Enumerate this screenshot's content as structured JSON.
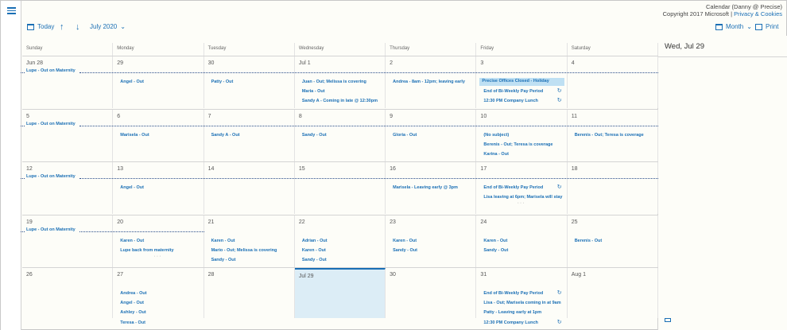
{
  "app": {
    "title_line": "Calendar (Danny @ Precise)",
    "copyright": "Copyright 2017 Microsoft",
    "separator": "|",
    "privacy_link": "Privacy & Cookies"
  },
  "toolbar": {
    "today_label": "Today",
    "month_label": "July 2020",
    "view_label": "Month",
    "print_label": "Print"
  },
  "days_of_week": [
    "Sunday",
    "Monday",
    "Tuesday",
    "Wednesday",
    "Thursday",
    "Friday",
    "Saturday"
  ],
  "weeks": [
    {
      "days": [
        "Jun 28",
        "29",
        "30",
        "Jul 1",
        "2",
        "3",
        "4"
      ],
      "span_event": "Lupe - Out on Maternity",
      "events": [
        [],
        [
          {
            "text": "Angel - Out"
          }
        ],
        [
          {
            "text": "Patty - Out"
          }
        ],
        [
          {
            "text": "Juan - Out; Melissa is covering"
          },
          {
            "text": "Maria - Out"
          },
          {
            "text": "Sandy A - Coming in late @ 12:30pm"
          }
        ],
        [
          {
            "text": "Andrea - 8am - 12pm; leaving early"
          }
        ],
        [
          {
            "text": "Precise Offices Closed - Holiday",
            "holiday": true
          },
          {
            "text": "End of Bi-Weekly Pay Period",
            "recur": true
          },
          {
            "text": "12:30 PM Company Lunch",
            "recur": true
          }
        ],
        []
      ]
    },
    {
      "days": [
        "5",
        "6",
        "7",
        "8",
        "9",
        "10",
        "11"
      ],
      "span_event": "Lupe - Out on Maternity",
      "events": [
        [],
        [
          {
            "text": "Marisela - Out"
          }
        ],
        [
          {
            "text": "Sandy A - Out"
          }
        ],
        [
          {
            "text": "Sandy - Out"
          }
        ],
        [
          {
            "text": "Gloria - Out"
          }
        ],
        [
          {
            "text": "(No subject)"
          },
          {
            "text": "Berenis - Out; Teresa is coverage"
          },
          {
            "text": "Karina - Out"
          }
        ],
        [
          {
            "text": "Berenis - Out; Teresa is coverage"
          }
        ]
      ]
    },
    {
      "days": [
        "12",
        "13",
        "14",
        "15",
        "16",
        "17",
        "18"
      ],
      "span_event": "Lupe - Out on Maternity",
      "events": [
        [],
        [
          {
            "text": "Angel - Out"
          }
        ],
        [],
        [],
        [
          {
            "text": "Marisela - Leaving early @ 3pm"
          }
        ],
        [
          {
            "text": "End of Bi-Weekly Pay Period",
            "recur": true
          },
          {
            "text": "Lisa leaving at 6pm; Marisela will stay"
          }
        ],
        []
      ],
      "more_day": 5
    },
    {
      "days": [
        "19",
        "20",
        "21",
        "22",
        "23",
        "24",
        "25"
      ],
      "span_event": "Lupe - Out on Maternity",
      "events": [
        [],
        [
          {
            "text": "Karen - Out"
          },
          {
            "text": "Lupe back from maternity"
          }
        ],
        [
          {
            "text": "Karen - Out"
          },
          {
            "text": "Mario - Out; Melissa is covering"
          },
          {
            "text": "Sandy - Out"
          }
        ],
        [
          {
            "text": "Adrian - Out"
          },
          {
            "text": "Karen - Out"
          },
          {
            "text": "Sandy - Out"
          }
        ],
        [
          {
            "text": "Karen - Out"
          },
          {
            "text": "Sandy - Out"
          }
        ],
        [
          {
            "text": "Karen - Out"
          },
          {
            "text": "Sandy - Out"
          }
        ],
        [
          {
            "text": "Berenis - Out"
          }
        ]
      ],
      "more_day": 1
    },
    {
      "days": [
        "26",
        "27",
        "28",
        "Jul 29",
        "30",
        "31",
        "Aug 1"
      ],
      "span_event": "",
      "events": [
        [],
        [
          {
            "text": "Andrea - Out"
          },
          {
            "text": "Angel - Out"
          },
          {
            "text": "Ashley - Out"
          },
          {
            "text": "Teresa - Out"
          }
        ],
        [],
        [],
        [],
        [
          {
            "text": "End of Bi-Weekly Pay Period",
            "recur": true
          },
          {
            "text": "Lisa - Out; Marisela coming in at 9am"
          },
          {
            "text": "Patty - Leaving early at 1pm"
          },
          {
            "text": "12:30 PM Company Lunch",
            "recur": true
          }
        ],
        []
      ],
      "today_index": 3
    }
  ],
  "panel": {
    "date_title": "Wed, Jul 29"
  },
  "colors": {
    "accent": "#1a6fb5",
    "today_bg": "#dcedf6",
    "holiday_bg": "#bfe0f3"
  }
}
